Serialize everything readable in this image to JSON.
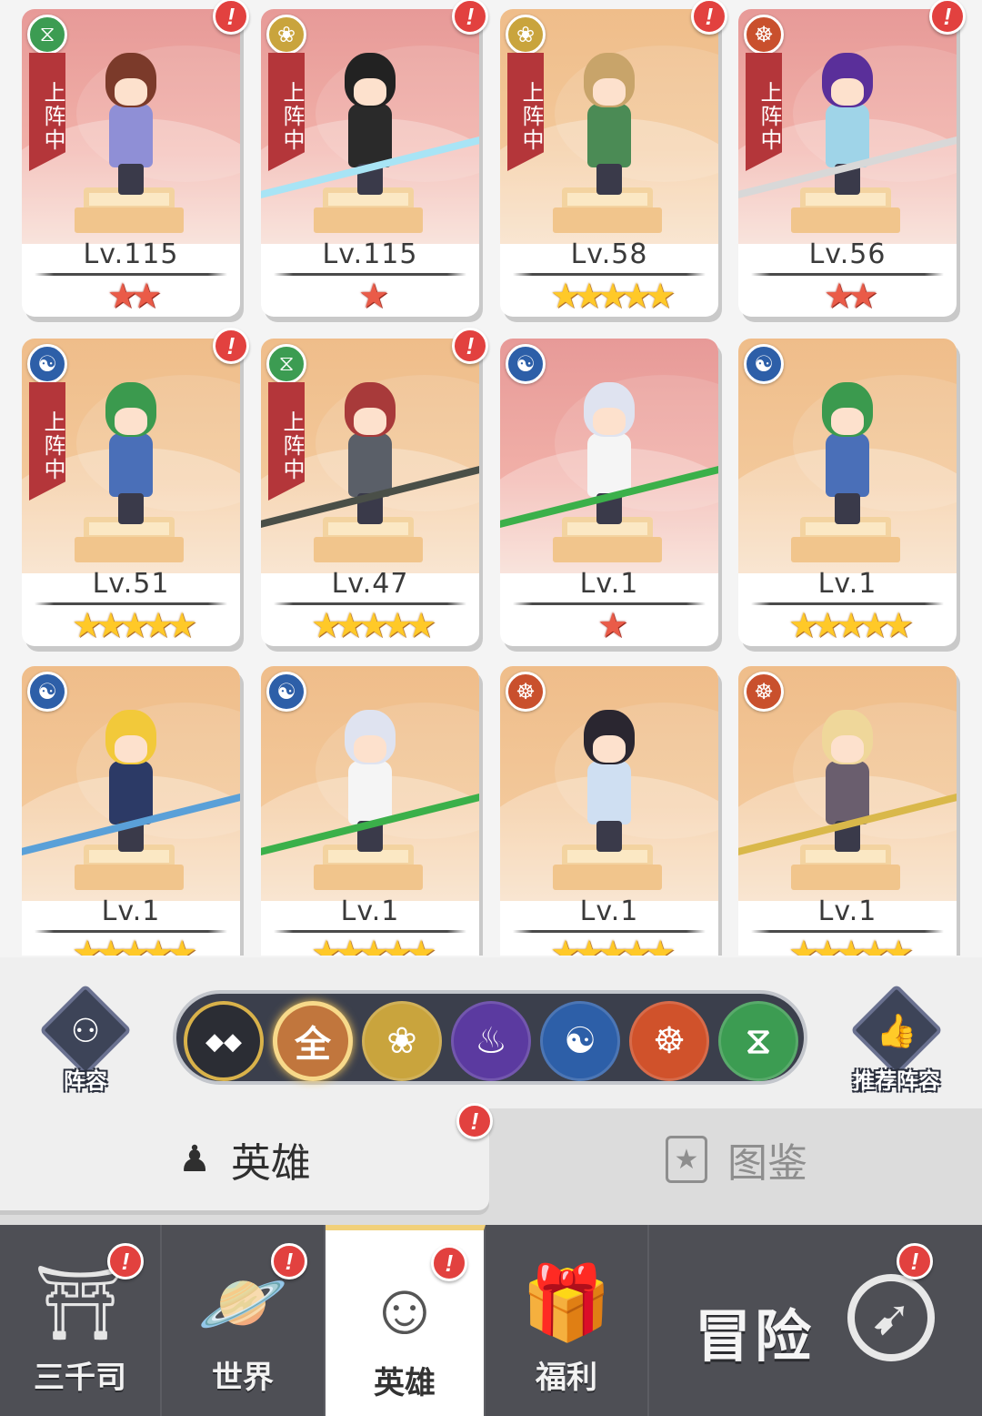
{
  "heroes": [
    {
      "level": "Lv.115",
      "stars": 2,
      "star_color": "red",
      "bg": "pink",
      "faction_icon": "dna-icon",
      "faction_color": "#3c9c52",
      "faction_glyph": "⧖",
      "deployed": true,
      "alert": true,
      "hair": "#7b3a2a",
      "outfit": "#8f8fd6",
      "weapon": null
    },
    {
      "level": "Lv.115",
      "stars": 1,
      "star_color": "red",
      "bg": "pink",
      "faction_icon": "lotus-icon",
      "faction_color": "#c9a43d",
      "faction_glyph": "❀",
      "deployed": true,
      "alert": true,
      "hair": "#222222",
      "outfit": "#2a2a2a",
      "weapon": "#a8e4f5"
    },
    {
      "level": "Lv.58",
      "stars": 5,
      "star_color": "gold",
      "bg": "orange",
      "faction_icon": "lotus-icon",
      "faction_color": "#c9a43d",
      "faction_glyph": "❀",
      "deployed": true,
      "alert": true,
      "hair": "#c8a46a",
      "outfit": "#4b8b55",
      "weapon": null
    },
    {
      "level": "Lv.56",
      "stars": 2,
      "star_color": "red",
      "bg": "pink",
      "faction_icon": "meditation-icon",
      "faction_color": "#c9502d",
      "faction_glyph": "☸",
      "deployed": true,
      "alert": true,
      "hair": "#5a2f9a",
      "outfit": "#9fd4e8",
      "weapon": "#d8d8d8"
    },
    {
      "level": "Lv.51",
      "stars": 5,
      "star_color": "gold",
      "bg": "orange",
      "faction_icon": "yin-yang-icon",
      "faction_color": "#2d5fa8",
      "faction_glyph": "☯",
      "deployed": true,
      "alert": true,
      "hair": "#3b9a4e",
      "outfit": "#4a6fb8",
      "weapon": null
    },
    {
      "level": "Lv.47",
      "stars": 5,
      "star_color": "gold",
      "bg": "orange",
      "faction_icon": "dna-icon",
      "faction_color": "#3c9c52",
      "faction_glyph": "⧖",
      "deployed": true,
      "alert": true,
      "hair": "#a83a3a",
      "outfit": "#5a5f68",
      "weapon": "#4a4f48"
    },
    {
      "level": "Lv.1",
      "stars": 1,
      "star_color": "red",
      "bg": "pink",
      "faction_icon": "yin-yang-icon",
      "faction_color": "#2d5fa8",
      "faction_glyph": "☯",
      "deployed": false,
      "alert": false,
      "hair": "#dfe3f0",
      "outfit": "#f5f5f5",
      "weapon": "#3bb04a"
    },
    {
      "level": "Lv.1",
      "stars": 5,
      "star_color": "gold",
      "bg": "orange",
      "faction_icon": "yin-yang-icon",
      "faction_color": "#2d5fa8",
      "faction_glyph": "☯",
      "deployed": false,
      "alert": false,
      "hair": "#3b9a4e",
      "outfit": "#4a6fb8",
      "weapon": null
    },
    {
      "level": "Lv.1",
      "stars": 5,
      "star_color": "gold",
      "bg": "orange",
      "faction_icon": "yin-yang-icon",
      "faction_color": "#2d5fa8",
      "faction_glyph": "☯",
      "deployed": false,
      "alert": false,
      "hair": "#f2c93a",
      "outfit": "#2c3a66",
      "weapon": "#5aa0d8"
    },
    {
      "level": "Lv.1",
      "stars": 5,
      "star_color": "gold",
      "bg": "orange",
      "faction_icon": "yin-yang-icon",
      "faction_color": "#2d5fa8",
      "faction_glyph": "☯",
      "deployed": false,
      "alert": false,
      "hair": "#dfe3f0",
      "outfit": "#f5f5f5",
      "weapon": "#3bb04a"
    },
    {
      "level": "Lv.1",
      "stars": 5,
      "star_color": "gold",
      "bg": "orange",
      "faction_icon": "meditation-icon",
      "faction_color": "#c9502d",
      "faction_glyph": "☸",
      "deployed": false,
      "alert": false,
      "hair": "#2a2630",
      "outfit": "#cfdff2",
      "weapon": null
    },
    {
      "level": "Lv.1",
      "stars": 5,
      "star_color": "gold",
      "bg": "orange",
      "faction_icon": "meditation-icon",
      "faction_color": "#c9502d",
      "faction_glyph": "☸",
      "deployed": false,
      "alert": false,
      "hair": "#efd79a",
      "outfit": "#6a5e6e",
      "weapon": "#d9b84a"
    }
  ],
  "deployed_label": "上阵中",
  "lineup_button": {
    "label": "阵容",
    "icon": "network-icon",
    "glyph": "⚇"
  },
  "recommend_button": {
    "label": "推荐阵容",
    "icon": "thumbs-up-icon",
    "glyph": "👍"
  },
  "faction_filters": [
    {
      "name": "diamond-grid",
      "glyph": "◆◆",
      "color": "#2b2d34",
      "selected": false
    },
    {
      "name": "all",
      "glyph": "全",
      "color": "#c1763d",
      "selected": true
    },
    {
      "name": "lotus",
      "glyph": "❀",
      "color": "#c9a43d",
      "selected": false
    },
    {
      "name": "flame",
      "glyph": "♨",
      "color": "#5b3aa0",
      "selected": false
    },
    {
      "name": "yin-yang",
      "glyph": "☯",
      "color": "#2d5fa8",
      "selected": false
    },
    {
      "name": "meditation",
      "glyph": "☸",
      "color": "#d0522b",
      "selected": false
    },
    {
      "name": "dna",
      "glyph": "⧖",
      "color": "#3c9c52",
      "selected": false
    }
  ],
  "tabs": {
    "heroes": {
      "label": "英雄",
      "icon": "person-icon",
      "glyph": "♟"
    },
    "codex": {
      "label": "图鉴",
      "icon": "card-star-icon",
      "glyph": "★"
    }
  },
  "bottom_nav": [
    {
      "label": "三千司",
      "icon": "temple-icon",
      "glyph": "⛩",
      "alert": true,
      "active": false
    },
    {
      "label": "世界",
      "icon": "planet-icon",
      "glyph": "🪐",
      "alert": true,
      "active": false
    },
    {
      "label": "英雄",
      "icon": "hero-icon",
      "glyph": "☺",
      "alert": true,
      "active": true
    },
    {
      "label": "福利",
      "icon": "gift-box-icon",
      "glyph": "🎁",
      "alert": false,
      "active": false
    }
  ],
  "adventure": {
    "label": "冒险",
    "icon": "compass-icon",
    "glyph": "➹",
    "alert": true
  },
  "alert_glyph": "!"
}
